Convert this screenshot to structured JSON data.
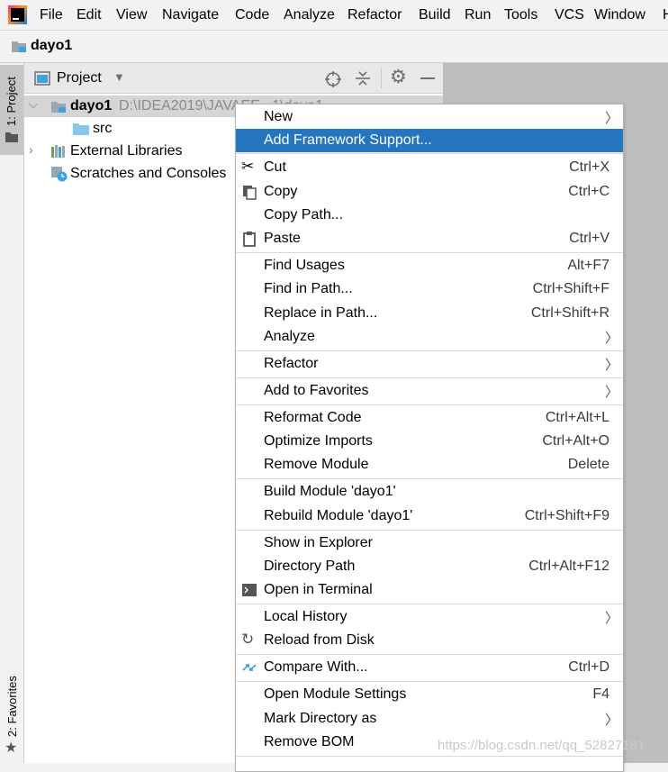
{
  "menubar": {
    "items": [
      "File",
      "Edit",
      "View",
      "Navigate",
      "Code",
      "Analyze",
      "Refactor",
      "Build",
      "Run",
      "Tools",
      "VCS",
      "Window",
      "H"
    ]
  },
  "breadcrumb": {
    "project": "dayo1"
  },
  "left_strip": {
    "project_tab": "1: Project",
    "favorites_tab": "2: Favorites"
  },
  "project_panel": {
    "title": "Project",
    "tree": {
      "root_name": "dayo1",
      "root_path": "D:\\IDEA2019\\JAVAEE...1\\dayo1",
      "src": "src",
      "external_libraries": "External Libraries",
      "scratches": "Scratches and Consoles"
    }
  },
  "context_menu": {
    "items": [
      {
        "label": "New",
        "shortcut": "",
        "submenu": true
      },
      {
        "label": "Add Framework Support...",
        "shortcut": "",
        "submenu": false
      },
      {
        "label": "Cut",
        "shortcut": "Ctrl+X",
        "submenu": false
      },
      {
        "label": "Copy",
        "shortcut": "Ctrl+C",
        "submenu": false
      },
      {
        "label": "Copy Path...",
        "shortcut": "",
        "submenu": false
      },
      {
        "label": "Paste",
        "shortcut": "Ctrl+V",
        "submenu": false
      },
      {
        "label": "Find Usages",
        "shortcut": "Alt+F7",
        "submenu": false
      },
      {
        "label": "Find in Path...",
        "shortcut": "Ctrl+Shift+F",
        "submenu": false
      },
      {
        "label": "Replace in Path...",
        "shortcut": "Ctrl+Shift+R",
        "submenu": false
      },
      {
        "label": "Analyze",
        "shortcut": "",
        "submenu": true
      },
      {
        "label": "Refactor",
        "shortcut": "",
        "submenu": true
      },
      {
        "label": "Add to Favorites",
        "shortcut": "",
        "submenu": true
      },
      {
        "label": "Reformat Code",
        "shortcut": "Ctrl+Alt+L",
        "submenu": false
      },
      {
        "label": "Optimize Imports",
        "shortcut": "Ctrl+Alt+O",
        "submenu": false
      },
      {
        "label": "Remove Module",
        "shortcut": "Delete",
        "submenu": false
      },
      {
        "label": "Build Module 'dayo1'",
        "shortcut": "",
        "submenu": false
      },
      {
        "label": "Rebuild Module 'dayo1'",
        "shortcut": "Ctrl+Shift+F9",
        "submenu": false
      },
      {
        "label": "Show in Explorer",
        "shortcut": "",
        "submenu": false
      },
      {
        "label": "Directory Path",
        "shortcut": "Ctrl+Alt+F12",
        "submenu": false
      },
      {
        "label": "Open in Terminal",
        "shortcut": "",
        "submenu": false
      },
      {
        "label": "Local History",
        "shortcut": "",
        "submenu": true
      },
      {
        "label": "Reload from Disk",
        "shortcut": "",
        "submenu": false
      },
      {
        "label": "Compare With...",
        "shortcut": "Ctrl+D",
        "submenu": false
      },
      {
        "label": "Open Module Settings",
        "shortcut": "F4",
        "submenu": false
      },
      {
        "label": "Mark Directory as",
        "shortcut": "",
        "submenu": true
      },
      {
        "label": "Remove BOM",
        "shortcut": "",
        "submenu": false
      }
    ]
  },
  "watermark": "https://blog.csdn.net/qq_52827181",
  "colors": {
    "highlight": "#2675bf",
    "editor_bg": "#bdbdbd",
    "folder_blue": "#87c8f0"
  }
}
